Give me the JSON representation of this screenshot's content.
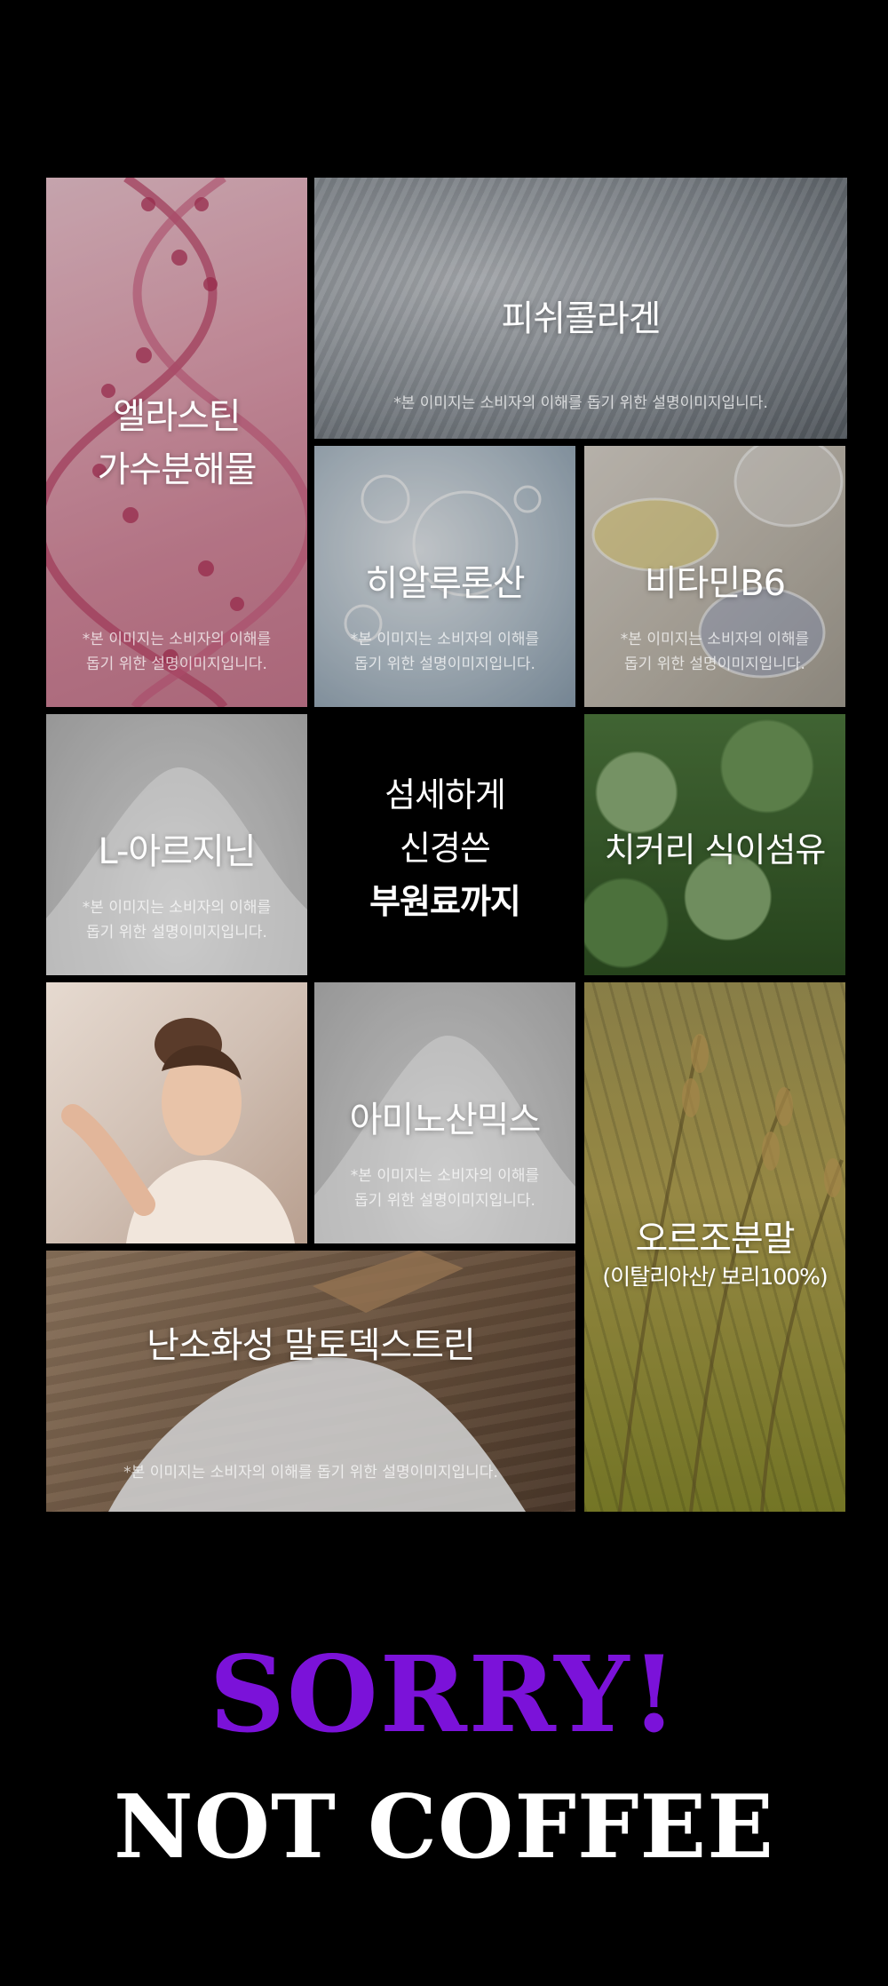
{
  "tiles": {
    "elastin": {
      "title_line1": "엘라스틴",
      "title_line2": "가수분해물",
      "note_line1": "*본 이미지는 소비자의 이해를",
      "note_line2": "돕기 위한 설명이미지입니다."
    },
    "fish_collagen": {
      "title": "피쉬콜라겐",
      "note": "*본 이미지는 소비자의 이해를 돕기 위한 설명이미지입니다."
    },
    "hyaluronic": {
      "title": "히알루론산",
      "note_line1": "*본 이미지는 소비자의 이해를",
      "note_line2": "돕기 위한 설명이미지입니다."
    },
    "vitamin_b6": {
      "title": "비타민B6",
      "note_line1": "*본 이미지는 소비자의 이해를",
      "note_line2": "돕기 위한 설명이미지입니다."
    },
    "l_arginine": {
      "title": "L-아르지닌",
      "note_line1": "*본 이미지는 소비자의 이해를",
      "note_line2": "돕기 위한 설명이미지입니다."
    },
    "center": {
      "line1": "섬세하게",
      "line2": "신경쓴",
      "line3": "부원료까지"
    },
    "chicory": {
      "title": "치커리 식이섬유"
    },
    "amino": {
      "title": "아미노산믹스",
      "note_line1": "*본 이미지는 소비자의 이해를",
      "note_line2": "돕기 위한 설명이미지입니다."
    },
    "oats": {
      "title": "오르조분말",
      "subtitle": "(이탈리아산/ 보리100%)"
    },
    "maltodextrin": {
      "title": "난소화성 말토덱스트린",
      "note": "*본 이미지는 소비자의 이해를 돕기 위한 설명이미지입니다."
    }
  },
  "headline": {
    "line1": "SORRY!",
    "line2": "NOT COFFEE"
  },
  "colors": {
    "accent_purple": "#7b12d9",
    "white": "#ffffff",
    "background": "#000000"
  }
}
